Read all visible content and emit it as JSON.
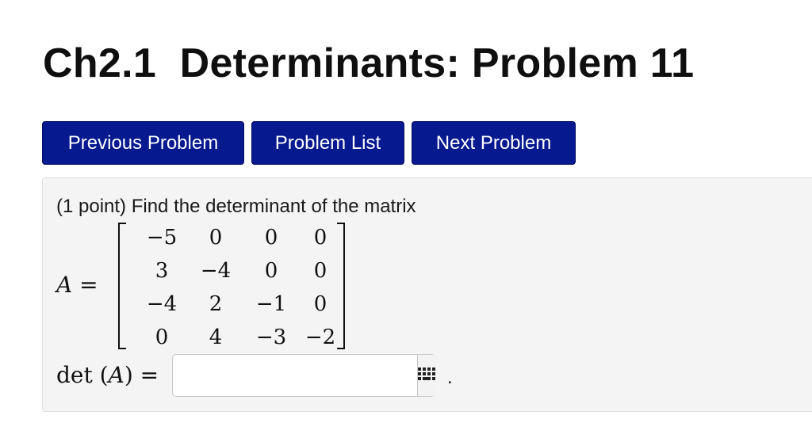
{
  "page": {
    "title": "Ch2.1  Determinants: Problem 11"
  },
  "nav": {
    "previous_label": "Previous Problem",
    "list_label": "Problem List",
    "next_label": "Next Problem",
    "button_color": "#06198f"
  },
  "problem": {
    "statement": "(1 point) Find the determinant of the matrix",
    "matrix_name": "A",
    "equals": "=",
    "matrix": [
      [
        "−5",
        "0",
        "0",
        "0"
      ],
      [
        "3",
        "−4",
        "0",
        "0"
      ],
      [
        "−4",
        "2",
        "−1",
        "0"
      ],
      [
        "0",
        "4",
        "−3",
        "−2"
      ]
    ],
    "det_fn": "det",
    "det_arg": "A",
    "answer": {
      "value": "",
      "placeholder": ""
    },
    "keypad_icon": "keypad-grid-icon",
    "trailing_period": "."
  }
}
